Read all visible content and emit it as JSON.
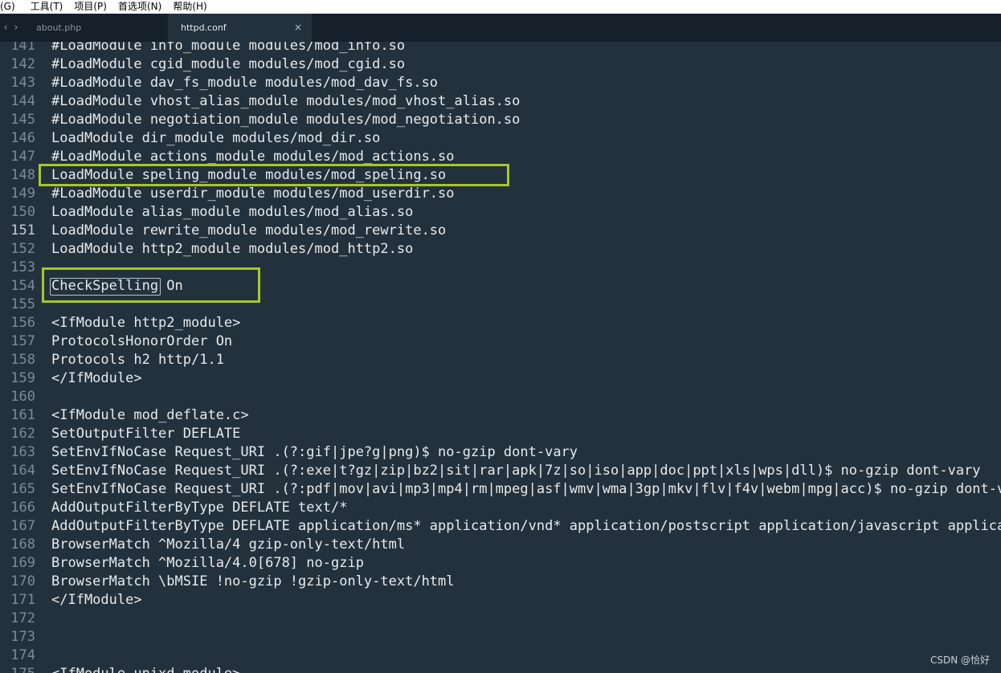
{
  "menu": [
    "(G)",
    "工具(T)",
    "项目(P)",
    "首选项(N)",
    "帮助(H)"
  ],
  "tabs": [
    {
      "label": "about.php",
      "active": false
    },
    {
      "label": "httpd.conf",
      "active": true,
      "close": "×"
    }
  ],
  "nav": {
    "back": "‹",
    "forward": "›"
  },
  "lines": [
    {
      "n": "141",
      "text": "#LoadModule info_module modules/mod_info.so"
    },
    {
      "n": "142",
      "text": "#LoadModule cgid_module modules/mod_cgid.so"
    },
    {
      "n": "143",
      "text": "#LoadModule dav_fs_module modules/mod_dav_fs.so"
    },
    {
      "n": "144",
      "text": "#LoadModule vhost_alias_module modules/mod_vhost_alias.so"
    },
    {
      "n": "145",
      "text": "#LoadModule negotiation_module modules/mod_negotiation.so"
    },
    {
      "n": "146",
      "text": "LoadModule dir_module modules/mod_dir.so"
    },
    {
      "n": "147",
      "text": "#LoadModule actions_module modules/mod_actions.so"
    },
    {
      "n": "148",
      "text": "LoadModule speling_module modules/mod_speling.so"
    },
    {
      "n": "149",
      "text": "#LoadModule userdir_module modules/mod_userdir.so"
    },
    {
      "n": "150",
      "text": "LoadModule alias_module modules/mod_alias.so"
    },
    {
      "n": "151",
      "text": "LoadModule rewrite_module modules/mod_rewrite.so"
    },
    {
      "n": "152",
      "text": "LoadModule http2_module modules/mod_http2.so"
    },
    {
      "n": "153",
      "text": ""
    },
    {
      "n": "154",
      "text": "CheckSpelling On"
    },
    {
      "n": "155",
      "text": ""
    },
    {
      "n": "156",
      "text": "<IfModule http2_module>"
    },
    {
      "n": "157",
      "text": "ProtocolsHonorOrder On"
    },
    {
      "n": "158",
      "text": "Protocols h2 http/1.1"
    },
    {
      "n": "159",
      "text": "</IfModule>"
    },
    {
      "n": "160",
      "text": ""
    },
    {
      "n": "161",
      "text": "<IfModule mod_deflate.c>"
    },
    {
      "n": "162",
      "text": "SetOutputFilter DEFLATE"
    },
    {
      "n": "163",
      "text": "SetEnvIfNoCase Request_URI .(?:gif|jpe?g|png)$ no-gzip dont-vary"
    },
    {
      "n": "164",
      "text": "SetEnvIfNoCase Request_URI .(?:exe|t?gz|zip|bz2|sit|rar|apk|7z|so|iso|app|doc|ppt|xls|wps|dll)$ no-gzip dont-vary"
    },
    {
      "n": "165",
      "text": "SetEnvIfNoCase Request_URI .(?:pdf|mov|avi|mp3|mp4|rm|mpeg|asf|wmv|wma|3gp|mkv|flv|f4v|webm|mpg|acc)$ no-gzip dont-vary"
    },
    {
      "n": "166",
      "text": "AddOutputFilterByType DEFLATE text/*"
    },
    {
      "n": "167",
      "text": "AddOutputFilterByType DEFLATE application/ms* application/vnd* application/postscript application/javascript application/x-javascript"
    },
    {
      "n": "168",
      "text": "BrowserMatch ^Mozilla/4 gzip-only-text/html"
    },
    {
      "n": "169",
      "text": "BrowserMatch ^Mozilla/4.0[678] no-gzip"
    },
    {
      "n": "170",
      "text": "BrowserMatch \\bMSIE !no-gzip !gzip-only-text/html"
    },
    {
      "n": "171",
      "text": "</IfModule>"
    },
    {
      "n": "172",
      "text": ""
    },
    {
      "n": "173",
      "text": ""
    },
    {
      "n": "174",
      "text": ""
    },
    {
      "n": "175",
      "text": "<IfModule unixd_module>"
    }
  ],
  "current_line": "151",
  "watermark": "CSDN @恰好",
  "colors": {
    "highlight": "#a7c72a",
    "editor_bg": "#23313c",
    "tabbar_bg": "#15202a"
  }
}
